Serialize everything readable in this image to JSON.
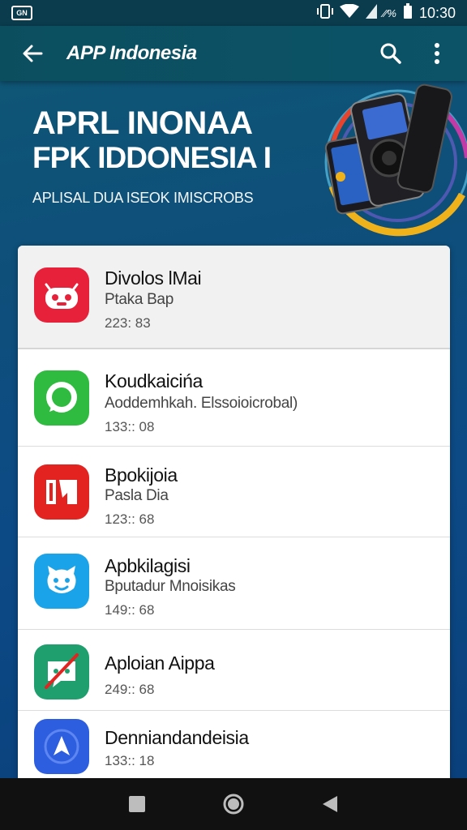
{
  "status_bar": {
    "time": "10:30",
    "signal_text": "⁄⁄%"
  },
  "app_bar": {
    "title": "APP Indonesia",
    "back_icon": "arrow-left-icon",
    "search_icon": "search-icon",
    "more_icon": "more-vert-icon"
  },
  "hero": {
    "line1": "APRL INONAA",
    "line2": "FPK IDDONESIA I",
    "subtitle": "APLISAL DUA ISEOK IMISCROBS"
  },
  "apps": [
    {
      "name": "Divolos lMai",
      "desc": "Ptaka Bap",
      "meta": "223: 83",
      "icon": "robot-face-icon",
      "color": "#e8213b"
    },
    {
      "name": "Koudkaicińa",
      "desc": "Aoddemhkah. Elssoioicrobal)",
      "meta": "133:: 08",
      "icon": "chat-bubble-icon",
      "color": "#2fbb3f"
    },
    {
      "name": "Bpokijoia",
      "desc": "Pasla Dia",
      "meta": "123:: 68",
      "icon": "red-tile-icon",
      "color": "#e2231f"
    },
    {
      "name": "Apbkilagisi",
      "desc": "Bputadur Mnoisikas",
      "meta": "149:: 68",
      "icon": "smiley-face-icon",
      "color": "#1aa3e8"
    },
    {
      "name": "Aploian Aippa",
      "desc": "",
      "meta": "249:: 68",
      "icon": "chat-slash-icon",
      "color": "#1f9e6e"
    },
    {
      "name": "Denniandandeisia",
      "desc": "",
      "meta": "133:: 18",
      "icon": "navigation-arrow-icon",
      "color": "#2e5ee0"
    }
  ],
  "nav_bar": {
    "recents_icon": "square-icon",
    "home_icon": "circle-icon",
    "back_icon": "triangle-back-icon"
  }
}
